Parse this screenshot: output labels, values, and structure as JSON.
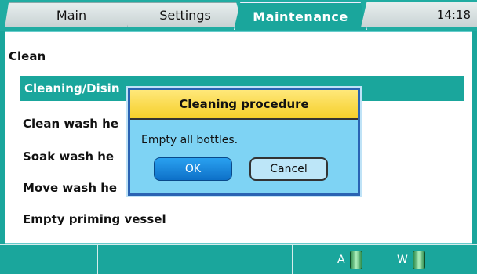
{
  "tabs": [
    {
      "label": "Main"
    },
    {
      "label": "Settings"
    },
    {
      "label": "Maintenance"
    }
  ],
  "clock": "14:18",
  "section": {
    "title": "Clean"
  },
  "list": {
    "items": [
      {
        "label": "Cleaning/Disin",
        "selected": true
      },
      {
        "label": "Clean wash he"
      },
      {
        "label": "Soak wash he"
      },
      {
        "label": "Move wash he"
      },
      {
        "label": "Empty priming vessel"
      }
    ]
  },
  "dialog": {
    "title": "Cleaning procedure",
    "message": "Empty all bottles.",
    "ok_label": "OK",
    "cancel_label": "Cancel"
  },
  "statusbar": {
    "a_label": "A",
    "w_label": "W"
  },
  "colors": {
    "accent": "#1aa69c",
    "dialog_header": "#f5cf2a",
    "dialog_body": "#7ed3f4",
    "ok_button": "#0d70c8"
  }
}
